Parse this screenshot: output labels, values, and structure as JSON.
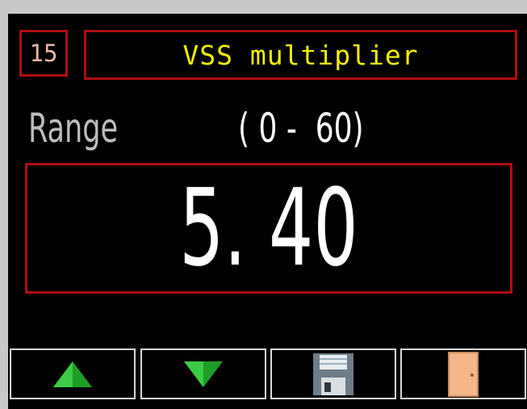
{
  "header": {
    "param_number": "15",
    "title": "VSS multiplier"
  },
  "range": {
    "label": "Range",
    "values": "( 0 -  60)"
  },
  "value": {
    "display": "5. 40"
  },
  "buttons": [
    {
      "name": "increment",
      "icon": "triangle-up-icon"
    },
    {
      "name": "decrement",
      "icon": "triangle-down-icon"
    },
    {
      "name": "save",
      "icon": "floppy-disk-icon"
    },
    {
      "name": "exit",
      "icon": "door-icon"
    }
  ],
  "colors": {
    "background": "#000000",
    "frame_border": "#b00d12",
    "title_text": "#f2f200",
    "param_number_text": "#e8b6a8",
    "range_label": "#bdbdbd",
    "value_text": "#ffffff",
    "arrow_green": "#26b32e",
    "door": "#f4b68a"
  }
}
